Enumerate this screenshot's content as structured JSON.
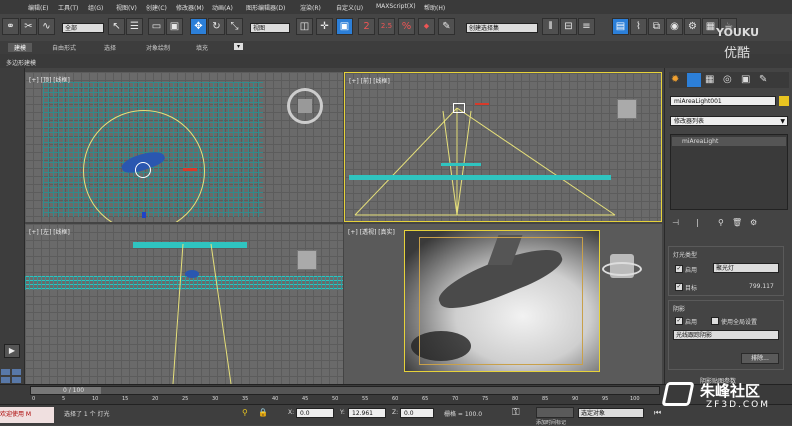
{
  "menu": [
    "编辑(E)",
    "工具(T)",
    "组(G)",
    "视图(V)",
    "创建(C)",
    "修改器(M)",
    "动画(A)",
    "图形编辑器(D)",
    "渲染(R)",
    "自定义(U)",
    "MAXScript(X)",
    "帮助(H)"
  ],
  "toolbar": {
    "filter_value": "全部",
    "viewport_coord_value": "视图",
    "named_selection_value": "创建选择集",
    "num_2": "2",
    "num_25": "2.5",
    "pct": "%",
    "num_3": "3"
  },
  "ribbon": {
    "tabs": [
      "建模",
      "自由形式",
      "选择",
      "对象绘制",
      "填充"
    ],
    "sub_label": "多边形建模"
  },
  "viewports": {
    "top_left": "[+] [顶] [线框]",
    "top_right": "[+] [前] [线框]",
    "bottom_left": "[+] [左] [线框]",
    "bottom_right": "[+] [透视] [真实]"
  },
  "command_panel": {
    "object_name": "miAreaLight001",
    "modifier_list": "修改器列表",
    "stack_item": "miAreaLight",
    "light_type_title": "灯光类型",
    "enable_label": "启用",
    "light_type_value": "聚光灯",
    "target_label": "目标",
    "target_value": "799.117",
    "shadow_title": "阴影",
    "shadow_enable_label": "启用",
    "global_settings_label": "使用全局设置",
    "shadow_type_value": "光线跟踪阴影",
    "exclude_button": "排除...",
    "shadow_params_title": "阴影贴图参数"
  },
  "timeline": {
    "frame_counter": "0 / 100",
    "ticks": [
      "0",
      "5",
      "10",
      "15",
      "20",
      "25",
      "30",
      "35",
      "40",
      "45",
      "50",
      "55",
      "60",
      "65",
      "70",
      "75",
      "80",
      "85",
      "90",
      "95",
      "100"
    ]
  },
  "status": {
    "mini_label": "欢迎使用 M",
    "message": "选择了 1 个 灯光",
    "x_label": "X:",
    "x_value": "0.0",
    "y_label": "Y:",
    "y_value": "12.961",
    "z_label": "Z:",
    "z_value": "0.0",
    "grid_label": "栅格 = 100.0",
    "key_filter_value": "选定对象",
    "add_time_tag": "添加时间标记"
  },
  "watermarks": {
    "youku_top": "YOUKU",
    "youku_bottom": "优酷",
    "zf3d_cn": "朱峰社区",
    "zf3d_url": "ZF3D.COM"
  },
  "colors": {
    "accent_blue": "#2c7fd8",
    "cyan_ocean": "#2fc4c0",
    "light_yellow": "#e8e08a"
  }
}
